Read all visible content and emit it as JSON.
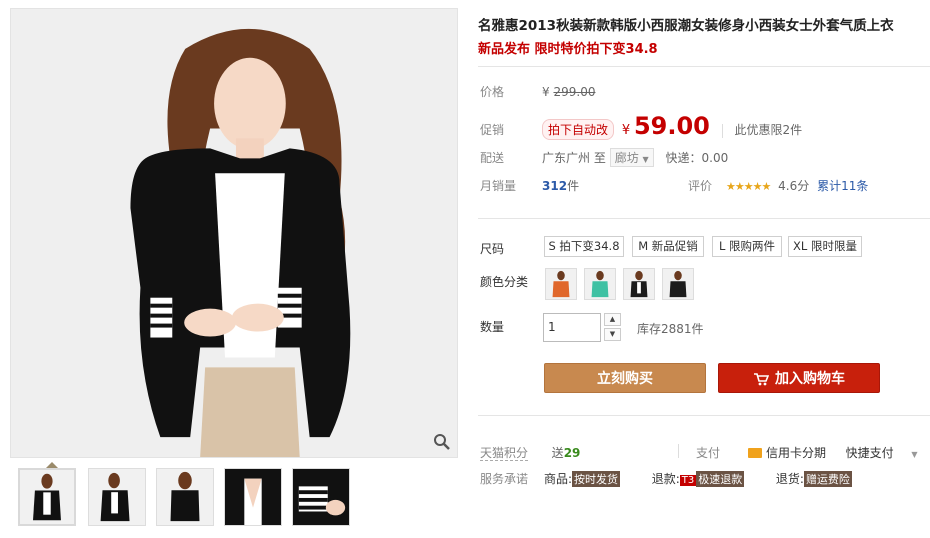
{
  "product": {
    "title": "名雅惠2013秋装新款韩版小西服潮女装修身小西装女士外套气质上衣",
    "subtitle": "新品发布 限时特价拍下变34.8"
  },
  "price": {
    "label": "价格",
    "currency": "¥",
    "original": "299.00"
  },
  "promo": {
    "label": "促销",
    "tag": "拍下自动改",
    "currency": "¥",
    "price": "59.00",
    "limit": "此优惠限2件"
  },
  "shipping": {
    "label": "配送",
    "from": "广东广州",
    "to_word": "至",
    "destination": "廊坊",
    "fee": "快递：0.00"
  },
  "sales": {
    "label": "月销量",
    "count": "312",
    "unit": "件",
    "rating_label": "评价",
    "stars": "★★★★★",
    "score": "4.6分",
    "review_count": "累计11条"
  },
  "sizes": {
    "label": "尺码",
    "options": [
      "S 拍下变34.8",
      "M 新品促销",
      "L 限购两件",
      "XL 限时限量"
    ]
  },
  "colors": {
    "label": "颜色分类",
    "swatches": [
      "#e0672b",
      "#3fc1a3",
      "#1c1c1c",
      "#1c1c1c"
    ]
  },
  "quantity": {
    "label": "数量",
    "value": "1",
    "stock": "库存2881件",
    "up_glyph": "▲",
    "down_glyph": "▼"
  },
  "actions": {
    "buy_now": "立刻购买",
    "add_to_cart": "加入购物车"
  },
  "points": {
    "label": "天猫积分",
    "send": "送",
    "value": "29",
    "pay_label": "支付",
    "credit": "信用卡分期",
    "quick_pay": "快捷支付"
  },
  "service": {
    "label": "服务承诺",
    "goods_label": "商品:",
    "goods_tag": "按时发货",
    "refund_label": "退款:",
    "refund_badge": "T3",
    "refund_tag": "极速退款",
    "return_label": "退货:",
    "return_tag": "赠运费险"
  },
  "colors_theme": {
    "accent_red": "#c40000",
    "buy_orange": "#c8894f",
    "cart_red": "#c8200c"
  }
}
